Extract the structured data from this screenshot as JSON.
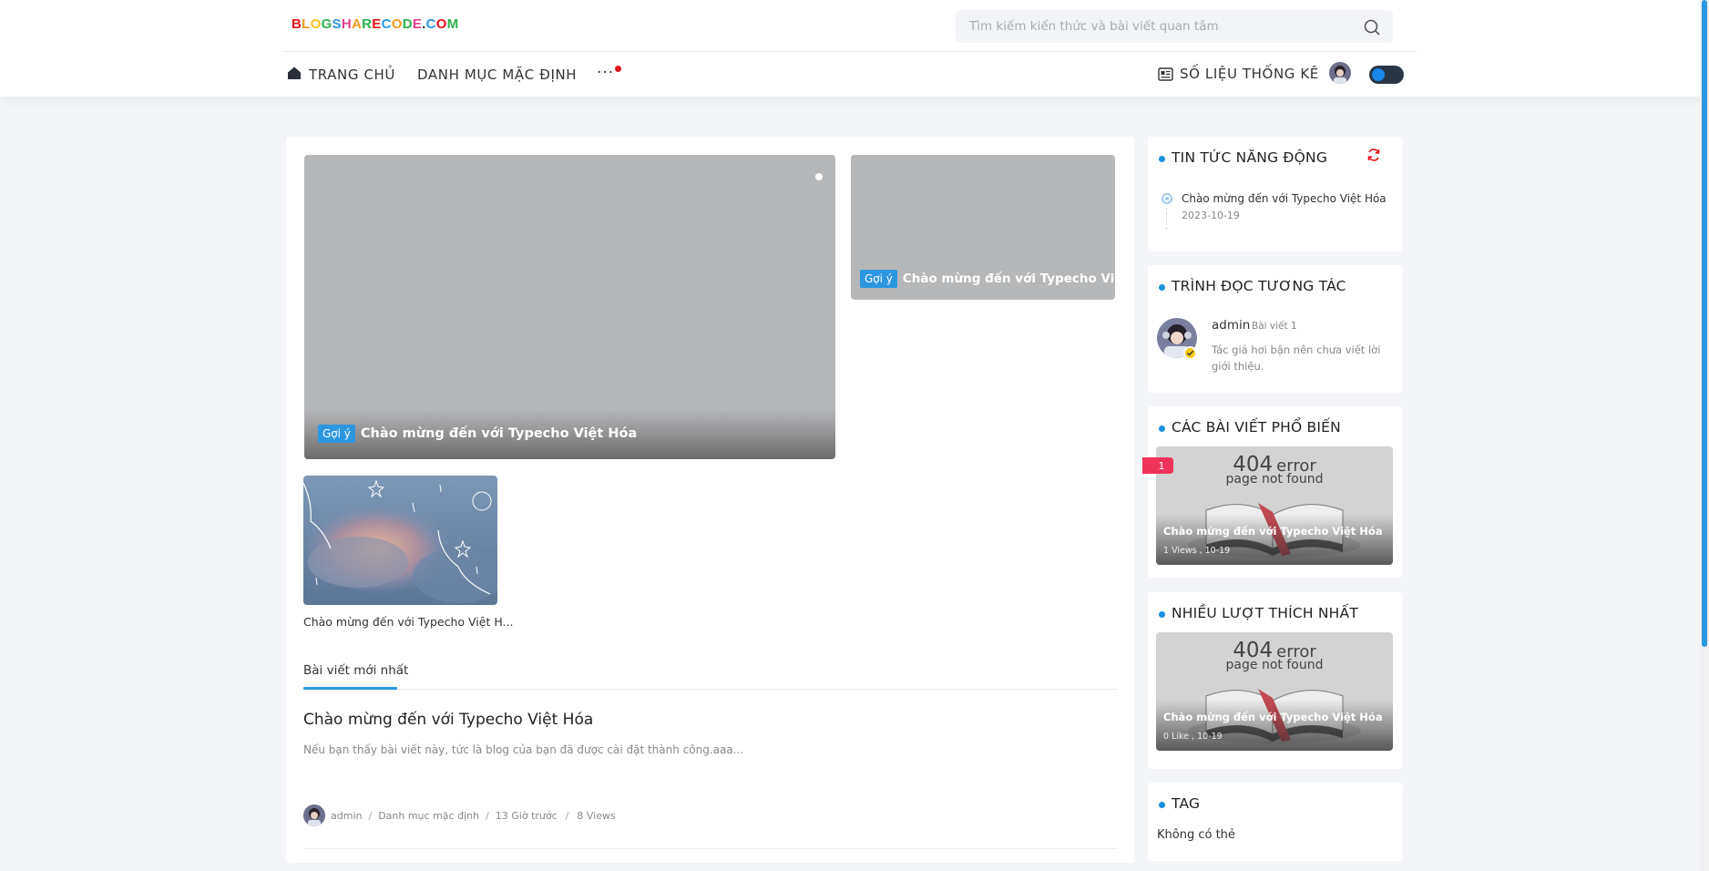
{
  "header": {
    "logo": [
      {
        "ch": "B",
        "color": "#e7131a"
      },
      {
        "ch": "L",
        "color": "#f29a1c"
      },
      {
        "ch": "O",
        "color": "#f2c31c"
      },
      {
        "ch": "G",
        "color": "#2bb24c"
      },
      {
        "ch": "S",
        "color": "#2b97e1"
      },
      {
        "ch": "H",
        "color": "#e43f8f"
      },
      {
        "ch": "A",
        "color": "#f29a1c"
      },
      {
        "ch": "R",
        "color": "#2bb24c"
      },
      {
        "ch": "E",
        "color": "#e7131a"
      },
      {
        "ch": "C",
        "color": "#2b97e1"
      },
      {
        "ch": "O",
        "color": "#f29a1c"
      },
      {
        "ch": "D",
        "color": "#2bb24c"
      },
      {
        "ch": "E",
        "color": "#e43f8f"
      },
      {
        "ch": ".",
        "color": "#333333"
      },
      {
        "ch": "C",
        "color": "#2b97e1"
      },
      {
        "ch": "O",
        "color": "#e7131a"
      },
      {
        "ch": "M",
        "color": "#2bb24c"
      }
    ],
    "search_placeholder": "Tìm kiếm kiến thức và bài viết quan tâm",
    "nav": {
      "home": "TRANG CHỦ",
      "category": "DANH MỤC MẶC ĐỊNH",
      "more": "···",
      "stats": "SỐ LIỆU THỐNG KÊ"
    },
    "icons": {
      "search": "search-icon",
      "home": "home-icon",
      "stats": "stats-icon",
      "theme": "theme-toggle"
    }
  },
  "main": {
    "hero": {
      "badge": "Gợi ý",
      "title": "Chào mừng đến với Typecho Việt Hóa"
    },
    "hero_side": {
      "badge": "Gợi ý",
      "title": "Chào mừng đến với Typecho Việt ..."
    },
    "thumb_title": "Chào mừng đến với Typecho Việt H...",
    "tab_latest": "Bài viết mới nhất",
    "post": {
      "title": "Chào mừng đến với Typecho Việt Hóa",
      "excerpt": "Nếu bạn thấy bài viết này, tức là blog của bạn đã được cài đặt thành công.aaa...",
      "author": "admin",
      "sep": "/",
      "category": "Danh mục mặc định",
      "time": "13 Giờ trước",
      "views": "8 Views"
    }
  },
  "sidebar": {
    "news": {
      "title": "TIN TỨC NĂNG ĐỘNG",
      "item_title": "Chào mừng đến với Typecho Việt Hóa",
      "item_date": "2023-10-19"
    },
    "readers": {
      "title": "TRÌNH ĐỌC TƯƠNG TÁC",
      "name": "admin",
      "count": "Bài viết 1",
      "bio": "Tác giả hơi bận nên chưa viết lời giới thiệu."
    },
    "popular": {
      "title": "CÁC BÀI VIẾT PHỔ BIẾN",
      "rank": "1",
      "err_code": "404",
      "err_word": "error",
      "err_sub": "page not found",
      "post_title": "Chào mừng đến với Typecho Việt Hóa",
      "meta": "1 Views ,  10-19"
    },
    "liked": {
      "title": "NHIỀU LƯỢT THÍCH NHẤT",
      "err_code": "404",
      "err_word": "error",
      "err_sub": "page not found",
      "post_title": "Chào mừng đến với Typecho Việt Hóa",
      "meta": "0 Like ,  10-19"
    },
    "tags": {
      "title": "TAG",
      "empty": "Không có thẻ"
    }
  },
  "colors": {
    "accent": "#2b97e1",
    "alert": "#e7131a",
    "rank_flag": "#f0335a"
  }
}
